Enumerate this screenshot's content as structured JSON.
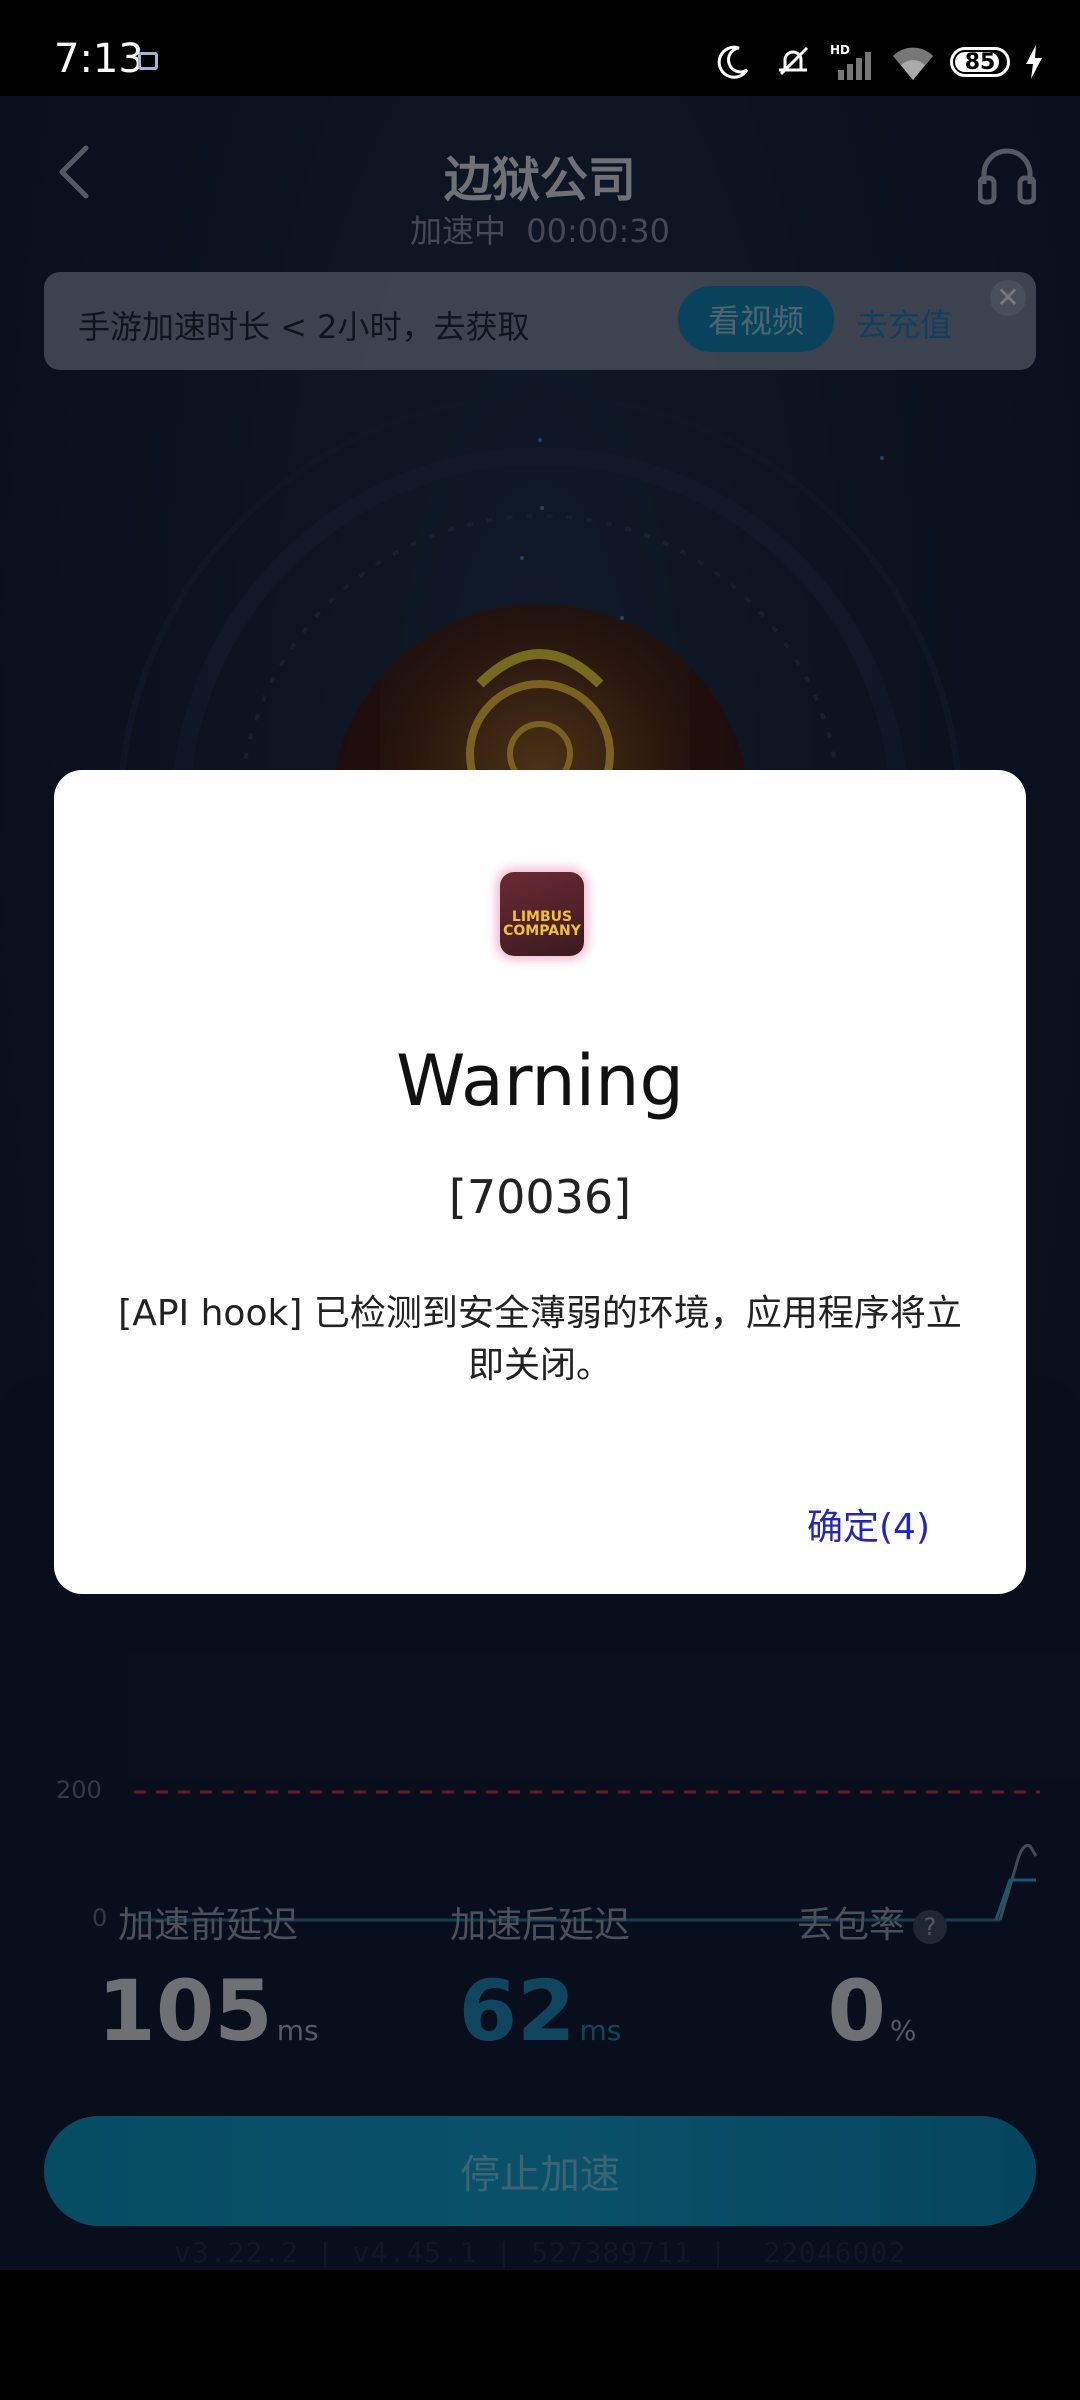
{
  "status_bar": {
    "time": "7:13",
    "network_badge": "HD",
    "battery": "85",
    "icons": [
      "image-notification-icon",
      "moon-icon",
      "silent-bell-icon",
      "signal-icon",
      "wifi-icon",
      "battery-icon",
      "charging-bolt-icon"
    ]
  },
  "header": {
    "title": "边狱公司",
    "subtitle": "加速中  00:00:30",
    "back_icon": "chevron-left-icon",
    "support_icon": "headset-icon"
  },
  "banner": {
    "text": "手游加速时长 < 2小时，去获取",
    "watch_label": "看视频",
    "recharge_label": "去充值",
    "close_glyph": "✕"
  },
  "chart": {
    "y_ticks": [
      "200",
      "0"
    ]
  },
  "stats": {
    "before": {
      "label": "加速前延迟",
      "value": "105",
      "unit": "ms"
    },
    "after": {
      "label": "加速后延迟",
      "value": "62",
      "unit": "ms"
    },
    "loss": {
      "label": "丢包率",
      "value": "0",
      "unit": "%",
      "help_glyph": "?"
    }
  },
  "stop_button": "停止加速",
  "version_line": "v3.22.2 | v4.45.1 | 527389711 |  22046002",
  "dialog": {
    "icon_text": "LIMBUS COMPANY",
    "title": "Warning",
    "code": "[70036]",
    "message": "[API hook] 已检测到安全薄弱的环境，应用程序将立即关闭。",
    "ok_label": "确定(4)"
  },
  "colors": {
    "accent": "#1089b8",
    "dialog_ok": "#2626b5",
    "threshold_line": "#c0353f"
  }
}
